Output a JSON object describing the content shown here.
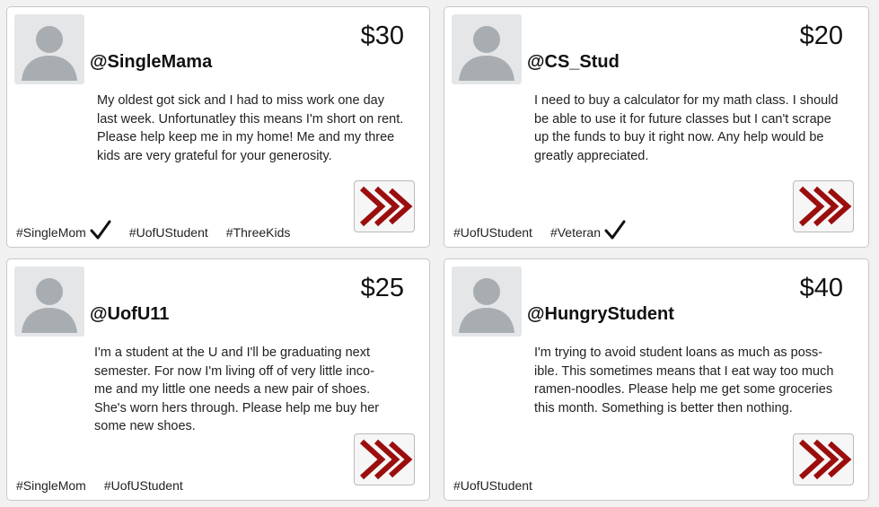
{
  "colors": {
    "forward_icon": "#9b0e0e",
    "avatar_bg": "#e4e6e8",
    "avatar_figure": "#a8adb1"
  },
  "posts": [
    {
      "username": "@SingleMama",
      "amount": "$30",
      "message": "My oldest got sick and I had to miss work one day last week. Unfortunatley this means I'm short on rent. Please help keep me in my home! Me and my three kids are very grateful for your generosity.",
      "tags": [
        {
          "label": "#SingleMom",
          "verified": true
        },
        {
          "label": "#UofUStudent",
          "verified": false
        },
        {
          "label": "#ThreeKids",
          "verified": false
        }
      ]
    },
    {
      "username": "@CS_Stud",
      "amount": "$20",
      "message": "I need to buy a calculator for my math class. I should be able to use it for future classes but I can't scrape up the funds to buy it right now. Any help would be greatly appreciated.",
      "tags": [
        {
          "label": "#UofUStudent",
          "verified": false
        },
        {
          "label": "#Veteran",
          "verified": true
        }
      ]
    },
    {
      "username": "@UofU11",
      "amount": "$25",
      "message": "I'm a student at the U and I'll be graduating next semester. For now I'm living off of very little inco-me and my little one needs a new pair of shoes. She's worn hers through. Please help me buy her some new shoes.",
      "tags": [
        {
          "label": "#SingleMom",
          "verified": false
        },
        {
          "label": "#UofUStudent",
          "verified": false
        }
      ]
    },
    {
      "username": "@HungryStudent",
      "amount": "$40",
      "message": "I'm trying to avoid student loans as much as poss-ible. This sometimes means that I eat way too much ramen-noodles. Please help me get some groceries this month. Something is better then nothing.",
      "tags": [
        {
          "label": "#UofUStudent",
          "verified": false
        }
      ]
    }
  ]
}
